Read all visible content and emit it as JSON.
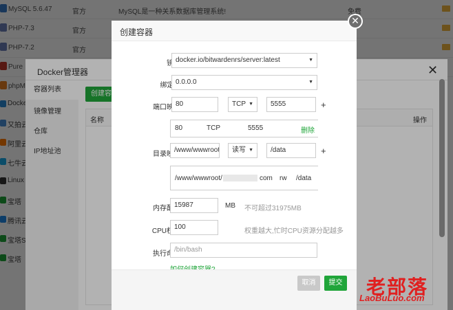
{
  "background_list": {
    "rows": [
      {
        "name": "MySQL 5.6.47",
        "dev": "官方",
        "desc": "MySQL是一种关系数据库管理系统!",
        "price": "免费",
        "icon_color": "#3a7bc8"
      },
      {
        "name": "PHP-7.3",
        "dev": "官方",
        "desc": "",
        "price": "",
        "icon_color": "#6c7eb7"
      },
      {
        "name": "PHP-7.2",
        "dev": "官方",
        "desc": "",
        "price": "",
        "icon_color": "#6c7eb7"
      },
      {
        "name": "Pure",
        "dev": "",
        "desc": "",
        "price": "",
        "icon_color": "#c0392b"
      },
      {
        "name": "phpM",
        "dev": "",
        "desc": "",
        "price": "",
        "icon_color": "#e67e22"
      }
    ],
    "side_items": [
      {
        "label": "Docke",
        "icon_color": "#2a8bd6"
      },
      {
        "label": "又拍云",
        "icon_color": "#4a90d9"
      },
      {
        "label": "阿里云",
        "icon_color": "#ff7a00"
      },
      {
        "label": "七牛云",
        "icon_color": "#1aabe8"
      },
      {
        "label": "Linux",
        "icon_color": "#333333"
      },
      {
        "label": "宝塔",
        "icon_color": "#20a53a"
      },
      {
        "label": "腾讯云",
        "icon_color": "#1e88e5"
      },
      {
        "label": "宝塔S",
        "icon_color": "#20a53a"
      },
      {
        "label": "宝塔",
        "icon_color": "#20a53a"
      }
    ]
  },
  "docker_dialog": {
    "title": "Docker管理器",
    "close_glyph": "✕",
    "nav": [
      "容器列表",
      "镜像管理",
      "仓库",
      "IP地址池"
    ],
    "create_button": "创建容器",
    "table_headers": {
      "name": "名称",
      "ops": "操作"
    }
  },
  "modal": {
    "title": "创建容器",
    "close_glyph": "✕",
    "image": {
      "label": "镜像",
      "value": "docker.io/bitwardenrs/server:latest"
    },
    "bind_ip": {
      "label": "绑定IP",
      "value": "0.0.0.0"
    },
    "port_map": {
      "label": "端口映射",
      "host_port": "80",
      "protocol": "TCP",
      "container_port": "5555",
      "add_glyph": "+",
      "entry": {
        "host": "80",
        "protocol": "TCP",
        "container": "5555",
        "delete": "删除"
      }
    },
    "dir_map": {
      "label": "目录映射",
      "host_path": "/www/wwwroot/",
      "mode": "读写",
      "container_path": "/data",
      "add_glyph": "+",
      "entry": {
        "host_prefix": "/www/wwwroot/",
        "host_suffix": "com",
        "mode": "rw",
        "container": "/data"
      }
    },
    "memory": {
      "label": "内存配额",
      "value": "15987",
      "unit": "MB",
      "hint": "不可超过31975MB"
    },
    "cpu": {
      "label": "CPU权重",
      "value": "100",
      "hint": "权重越大,忙时CPU资源分配越多"
    },
    "command": {
      "label": "执行命令",
      "placeholder": "/bin/bash"
    },
    "more_link": "如何创建容器?",
    "cancel": "取消",
    "submit": "提交"
  },
  "watermark": {
    "cn": "老部落",
    "en": "LaoBuLuo.com"
  },
  "colors": {
    "accent": "#20a53a",
    "brand_red": "#e02020"
  }
}
